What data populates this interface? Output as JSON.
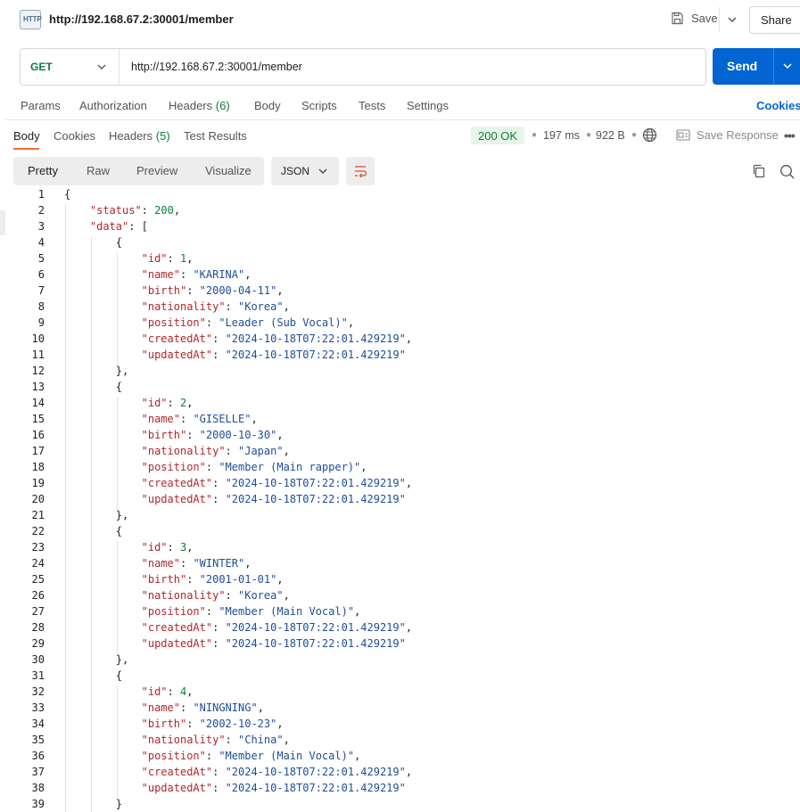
{
  "header": {
    "icon_label": "HTTP",
    "title": "http://192.168.67.2:30001/member",
    "save_label": "Save",
    "share_label": "Share"
  },
  "request": {
    "method": "GET",
    "url": "http://192.168.67.2:30001/member",
    "send_label": "Send"
  },
  "request_tabs": {
    "params": "Params",
    "authorization": "Authorization",
    "headers": "Headers",
    "headers_count": "(6)",
    "body": "Body",
    "scripts": "Scripts",
    "tests": "Tests",
    "settings": "Settings",
    "cookies": "Cookies"
  },
  "response_tabs": {
    "body": "Body",
    "cookies": "Cookies",
    "headers": "Headers",
    "headers_count": "(5)",
    "test_results": "Test Results"
  },
  "response_meta": {
    "status": "200 OK",
    "time": "197 ms",
    "size": "922 B",
    "save_response": "Save Response"
  },
  "format_bar": {
    "pretty": "Pretty",
    "raw": "Raw",
    "preview": "Preview",
    "visualize": "Visualize",
    "language": "JSON"
  },
  "colors": {
    "accent": "#0265d2",
    "status_green": "#0d7d3a",
    "active_tab": "#f26b3a",
    "json_key": "#b2262a",
    "json_string": "#1d4d9b"
  },
  "response_json": {
    "status": 200,
    "members": [
      {
        "id": 1,
        "name": "KARINA",
        "birth": "2000-04-11",
        "nationality": "Korea",
        "position": "Leader (Sub Vocal)",
        "createdAt": "2024-10-18T07:22:01.429219",
        "updatedAt": "2024-10-18T07:22:01.429219"
      },
      {
        "id": 2,
        "name": "GISELLE",
        "birth": "2000-10-30",
        "nationality": "Japan",
        "position": "Member (Main rapper)",
        "createdAt": "2024-10-18T07:22:01.429219",
        "updatedAt": "2024-10-18T07:22:01.429219"
      },
      {
        "id": 3,
        "name": "WINTER",
        "birth": "2001-01-01",
        "nationality": "Korea",
        "position": "Member (Main Vocal)",
        "createdAt": "2024-10-18T07:22:01.429219",
        "updatedAt": "2024-10-18T07:22:01.429219"
      },
      {
        "id": 4,
        "name": "NINGNING",
        "birth": "2002-10-23",
        "nationality": "China",
        "position": "Member (Main Vocal)",
        "createdAt": "2024-10-18T07:22:01.429219",
        "updatedAt": "2024-10-18T07:22:01.429219"
      }
    ]
  }
}
